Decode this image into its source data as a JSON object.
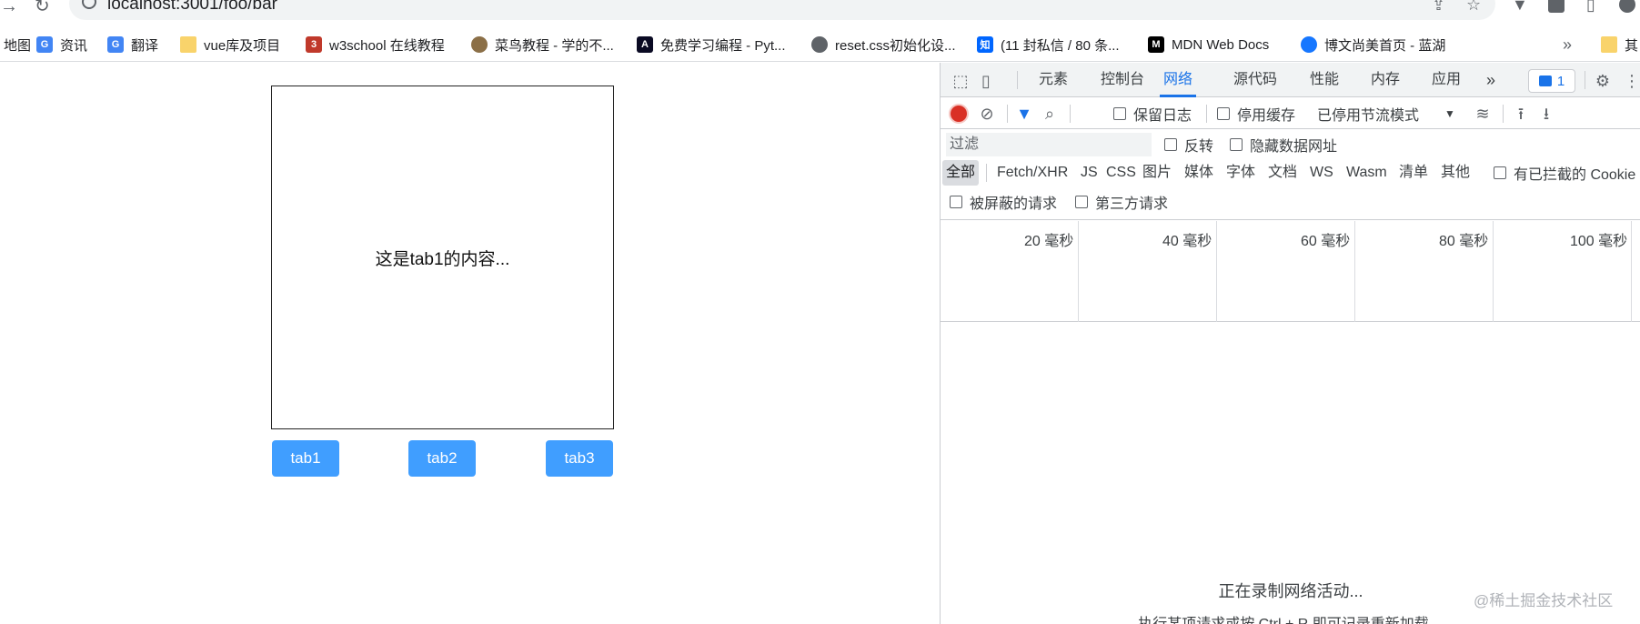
{
  "browser": {
    "url": "localhost:3001/foo/bar",
    "bookmarks": [
      {
        "label": "地图",
        "icon": "map-icon",
        "color": "#34a853"
      },
      {
        "label": "资讯",
        "icon": "news-icon",
        "color": "#4285f4"
      },
      {
        "label": "翻译",
        "icon": "translate-icon",
        "color": "#4285f4"
      },
      {
        "label": "vue库及项目",
        "icon": "folder-icon",
        "color": "#f9d36b"
      },
      {
        "label": "w3school 在线教程",
        "icon": "w3school-icon",
        "color": "#c0392b"
      },
      {
        "label": "菜鸟教程 - 学的不...",
        "icon": "runoob-icon",
        "color": "#8b6f47"
      },
      {
        "label": "免费学习编程 - Pyt...",
        "icon": "freecodecamp-icon",
        "color": "#0a0a23"
      },
      {
        "label": "reset.css初始化设...",
        "icon": "globe-icon",
        "color": "#5f6368"
      },
      {
        "label": "(11 封私信 / 80 条...",
        "icon": "zhihu-icon",
        "color": "#0066ff"
      },
      {
        "label": "MDN Web Docs",
        "icon": "mdn-icon",
        "color": "#000000"
      },
      {
        "label": "博文尚美首页 - 蓝湖",
        "icon": "lanhu-icon",
        "color": "#1677ff"
      }
    ],
    "bookmarks_overflow": "»",
    "bookmark_trailing": "其"
  },
  "page": {
    "content_text": "这是tab1的内容...",
    "tabs": [
      "tab1",
      "tab2",
      "tab3"
    ],
    "accent": "#409eff"
  },
  "devtools": {
    "tabs": [
      "元素",
      "控制台",
      "网络",
      "源代码",
      "性能",
      "内存",
      "应用"
    ],
    "active_tab": "网络",
    "more": "»",
    "issues_count": "1",
    "toolbar": {
      "preserve_log": "保留日志",
      "disable_cache": "停用缓存",
      "throttling": "已停用节流模式"
    },
    "filter": {
      "placeholder": "过滤",
      "invert": "反转",
      "hide_data_urls": "隐藏数据网址",
      "types": [
        "全部",
        "Fetch/XHR",
        "JS",
        "CSS",
        "图片",
        "媒体",
        "字体",
        "文档",
        "WS",
        "Wasm",
        "清单",
        "其他"
      ],
      "blocked_cookies": "有已拦截的 Cookie",
      "blocked_requests": "被屏蔽的请求",
      "third_party": "第三方请求"
    },
    "timeline_ticks": [
      "20 毫秒",
      "40 毫秒",
      "60 毫秒",
      "80 毫秒",
      "100 毫秒"
    ],
    "empty_message": "正在录制网络活动...",
    "empty_sub": "执行某项请求或按 Ctrl + R 即可记录重新加载。"
  },
  "watermark": "@稀土掘金技术社区"
}
